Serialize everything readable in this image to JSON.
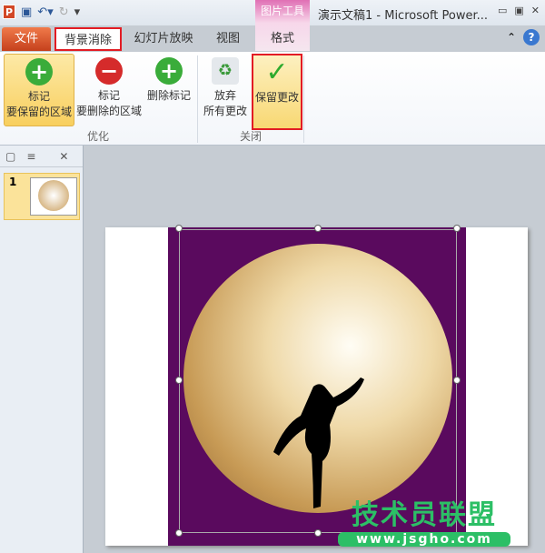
{
  "window": {
    "title": "演示文稿1 - Microsoft Power...",
    "context_group": "图片工具"
  },
  "qat": {
    "app_icon": "P"
  },
  "tabs": [
    {
      "label": "文件"
    },
    {
      "label": "背景消除"
    },
    {
      "label": "幻灯片放映"
    },
    {
      "label": "视图"
    },
    {
      "label": "格式"
    }
  ],
  "ribbon": {
    "buttons": [
      {
        "line1": "标记",
        "line2": "要保留的区域",
        "icon": "+"
      },
      {
        "line1": "标记",
        "line2": "要删除的区域",
        "icon": "−"
      },
      {
        "line1": "删除标记",
        "line2": "",
        "icon": "+"
      },
      {
        "line1": "放弃",
        "line2": "所有更改",
        "icon": "♻"
      },
      {
        "line1": "保留更改",
        "line2": "",
        "icon": "✓"
      }
    ],
    "groups": [
      {
        "label": "优化"
      },
      {
        "label": "关闭"
      }
    ]
  },
  "slides_panel": {
    "slide_number": "1"
  },
  "watermark": {
    "text": "技术员联盟",
    "url": "www.jsgho.com"
  }
}
